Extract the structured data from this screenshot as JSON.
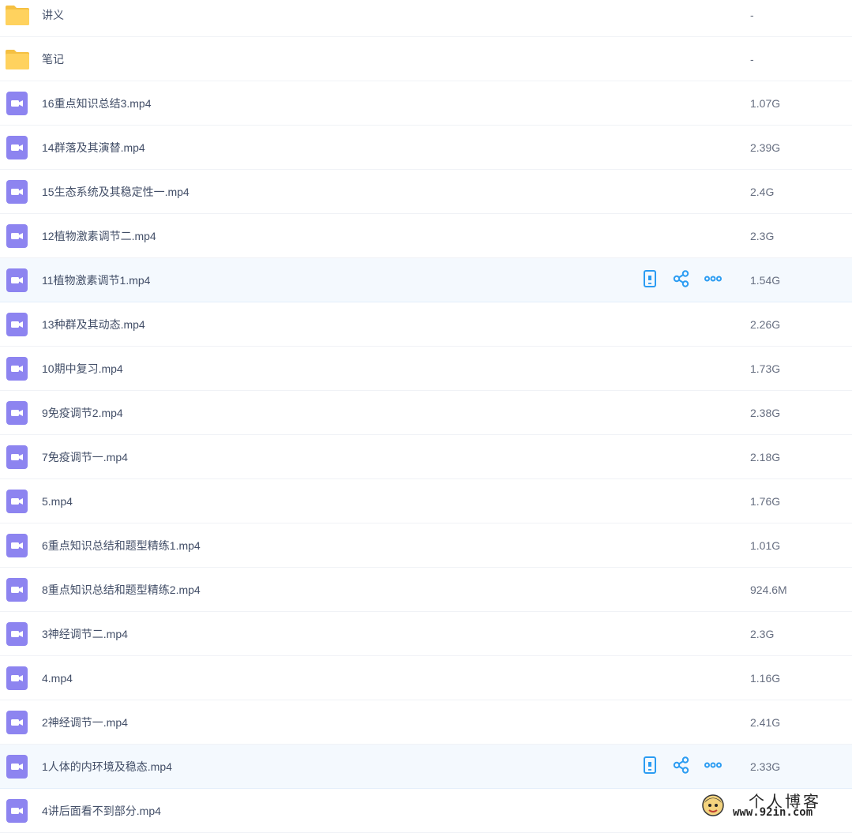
{
  "files": [
    {
      "type": "folder",
      "name": "讲义",
      "size": "-"
    },
    {
      "type": "folder",
      "name": "笔记",
      "size": "-"
    },
    {
      "type": "video",
      "name": "16重点知识总结3.mp4",
      "size": "1.07G"
    },
    {
      "type": "video",
      "name": "14群落及其演替.mp4",
      "size": "2.39G"
    },
    {
      "type": "video",
      "name": "15生态系统及其稳定性一.mp4",
      "size": "2.4G"
    },
    {
      "type": "video",
      "name": "12植物激素调节二.mp4",
      "size": "2.3G"
    },
    {
      "type": "video",
      "name": "11植物激素调节1.mp4",
      "size": "1.54G",
      "hover": true
    },
    {
      "type": "video",
      "name": "13种群及其动态.mp4",
      "size": "2.26G"
    },
    {
      "type": "video",
      "name": "10期中复习.mp4",
      "size": "1.73G"
    },
    {
      "type": "video",
      "name": "9免疫调节2.mp4",
      "size": "2.38G"
    },
    {
      "type": "video",
      "name": "7免疫调节一.mp4",
      "size": "2.18G"
    },
    {
      "type": "video",
      "name": "5.mp4",
      "size": "1.76G"
    },
    {
      "type": "video",
      "name": "6重点知识总结和题型精练1.mp4",
      "size": "1.01G"
    },
    {
      "type": "video",
      "name": "8重点知识总结和题型精练2.mp4",
      "size": "924.6M"
    },
    {
      "type": "video",
      "name": "3神经调节二.mp4",
      "size": "2.3G"
    },
    {
      "type": "video",
      "name": "4.mp4",
      "size": "1.16G"
    },
    {
      "type": "video",
      "name": "2神经调节一.mp4",
      "size": "2.41G"
    },
    {
      "type": "video",
      "name": "1人体的内环境及稳态.mp4",
      "size": "2.33G",
      "hover": true
    },
    {
      "type": "video",
      "name": "4讲后面看不到部分.mp4",
      "size": ""
    }
  ],
  "icons": {
    "folder": "folder-icon",
    "video": "video-file-icon",
    "phone": "phone-icon",
    "share": "share-icon",
    "more": "more-icon"
  },
  "colors": {
    "folder": "#ffd25e",
    "video": "#8d84f0",
    "action": "#2b9cf2",
    "hover_bg": "#f4f9fe"
  },
  "watermark": {
    "title": "个人博客",
    "url": "www.92in.com"
  }
}
